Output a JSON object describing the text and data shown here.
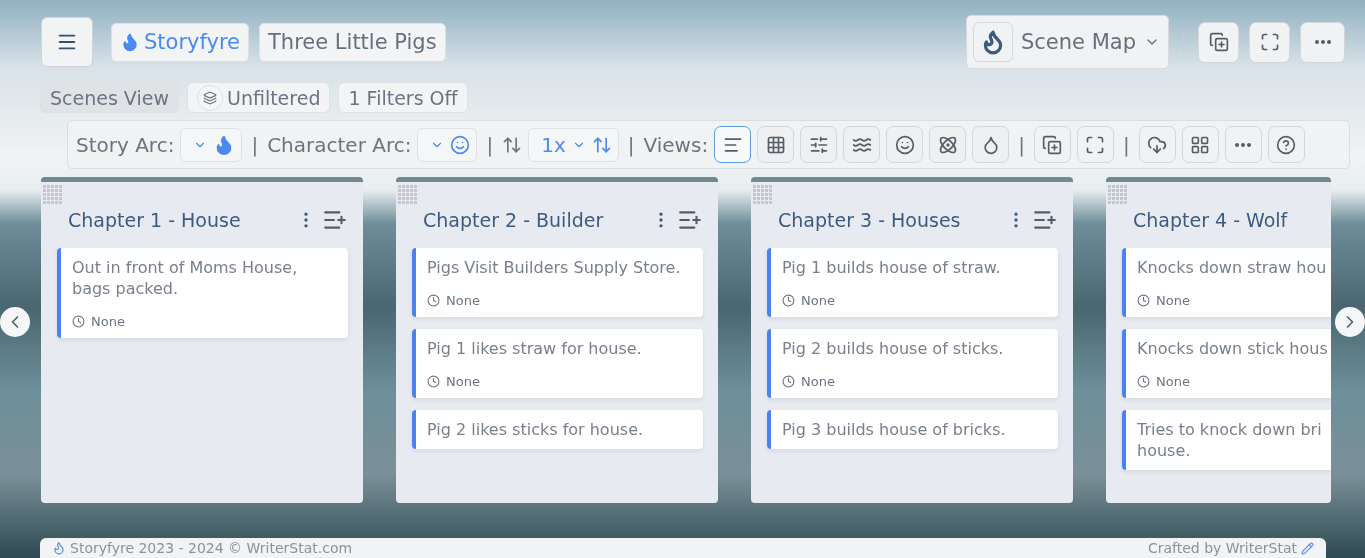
{
  "header": {
    "brand": "Storyfyre",
    "project": "Three Little Pigs",
    "scene_map": "Scene Map"
  },
  "filters": [
    {
      "label": "Scenes View",
      "kind": "plain",
      "selected": true
    },
    {
      "label": "Unfiltered",
      "kind": "with_icon",
      "selected": false
    },
    {
      "label": "1 Filters Off",
      "kind": "plain",
      "selected": false
    }
  ],
  "toolbar": {
    "story_arc": "Story Arc:",
    "character_arc": "Character Arc:",
    "zoom": "1x",
    "views_label": "Views:",
    "separators": [
      "|",
      "|",
      "|",
      "|",
      "|"
    ],
    "views": [
      {
        "selected": true
      },
      {
        "selected": false
      },
      {
        "selected": false
      },
      {
        "selected": false
      },
      {
        "selected": false
      },
      {
        "selected": false
      },
      {
        "selected": false
      }
    ]
  },
  "columns": [
    {
      "title": "Chapter 1 - House",
      "actions_visible": true,
      "scenes": [
        {
          "text": "Out in front of Moms House, bags packed.",
          "time": "None"
        }
      ]
    },
    {
      "title": "Chapter 2 - Builder",
      "actions_visible": true,
      "scenes": [
        {
          "text": "Pigs Visit Builders Supply Store.",
          "time": "None"
        },
        {
          "text": "Pig 1 likes straw for house.",
          "time": "None"
        },
        {
          "text": "Pig 2 likes sticks for house."
        }
      ]
    },
    {
      "title": "Chapter 3 - Houses",
      "actions_visible": true,
      "scenes": [
        {
          "text": "Pig 1 builds house of straw.",
          "time": "None"
        },
        {
          "text": "Pig 2 builds house of sticks.",
          "time": "None"
        },
        {
          "text": "Pig 3 builds house of bricks."
        }
      ]
    },
    {
      "title": "Chapter 4 - Wolf",
      "actions_visible": false,
      "scenes": [
        {
          "text": "Knocks down straw hou",
          "time": "None"
        },
        {
          "text": "Knocks down stick hous",
          "time": "None"
        },
        {
          "text": "Tries to knock down bri",
          "continuation": "house."
        }
      ]
    }
  ],
  "footer": {
    "left": "Storyfyre 2023 - 2024 ©  WriterStat.com",
    "right": "Crafted by WriterStat"
  }
}
